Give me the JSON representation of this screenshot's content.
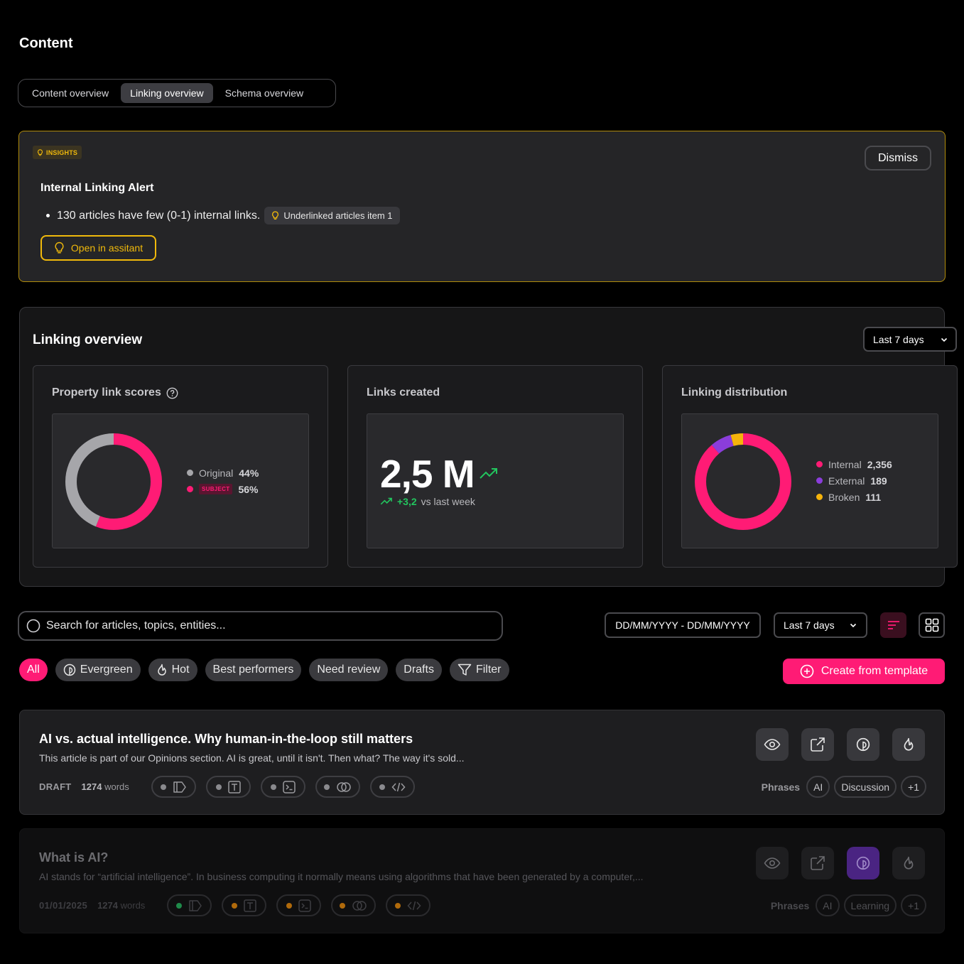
{
  "page": {
    "title": "Content"
  },
  "tabs": [
    {
      "label": "Content overview",
      "active": false
    },
    {
      "label": "Linking overview",
      "active": true
    },
    {
      "label": "Schema overview",
      "active": false
    }
  ],
  "insight": {
    "badge": "INSIGHTS",
    "title": "Internal Linking Alert",
    "bullet": "130 articles have few (0-1) internal links.",
    "chip": "Underlinked articles item 1",
    "assistant_button": "Open in assitant",
    "dismiss_button": "Dismiss"
  },
  "overview": {
    "title": "Linking overview",
    "range": "Last 7 days",
    "cards": {
      "scores": {
        "title": "Property link scores",
        "legend": [
          {
            "label": "Original",
            "value": "44%",
            "color": "#a6a6aa"
          },
          {
            "label": "SUBJECT",
            "value": "56%",
            "color": "#ff1b75"
          }
        ]
      },
      "links": {
        "title": "Links created",
        "value": "2,5 M",
        "delta": "+3,2",
        "delta_label": "vs last week"
      },
      "distribution": {
        "title": "Linking distribution",
        "legend": [
          {
            "label": "Internal",
            "value": "2,356",
            "color": "#ff1b75"
          },
          {
            "label": "External",
            "value": "189",
            "color": "#8b3ddb"
          },
          {
            "label": "Broken",
            "value": "111",
            "color": "#f5b30b"
          }
        ]
      }
    }
  },
  "toolbar": {
    "search_placeholder": "Search for articles, topics, entities...",
    "date_range": "DD/MM/YYYY - DD/MM/YYYY",
    "range": "Last 7 days",
    "create_button": "Create from template"
  },
  "filters": [
    {
      "label": "All",
      "icon": "",
      "active": true
    },
    {
      "label": "Evergreen",
      "icon": "leaf-icon",
      "active": false
    },
    {
      "label": "Hot",
      "icon": "flame-icon",
      "active": false
    },
    {
      "label": "Best performers",
      "icon": "",
      "active": false
    },
    {
      "label": "Need review",
      "icon": "",
      "active": false
    },
    {
      "label": "Drafts",
      "icon": "",
      "active": false
    },
    {
      "label": "Filter",
      "icon": "funnel-icon",
      "active": false
    }
  ],
  "articles": [
    {
      "title": "AI vs. actual intelligence. Why human-in-the-loop still matters",
      "excerpt": "This article is part of our Opinions section. AI is great, until it isn't. Then what? The way it's sold...",
      "status": "DRAFT",
      "words": "1274",
      "words_label": "words",
      "phrases_label": "Phrases",
      "phrases": [
        "AI",
        "Discussion",
        "+1"
      ],
      "pill_colors": [
        "#8a8a8e",
        "#8a8a8e",
        "#8a8a8e",
        "#8a8a8e",
        "#8a8a8e"
      ]
    },
    {
      "title": "What is AI?",
      "excerpt": "AI stands for “artificial intelligence”. In business computing it normally means using algorithms that have been generated by a computer,...",
      "status": "01/01/2025",
      "words": "1274",
      "words_label": "words",
      "phrases_label": "Phrases",
      "phrases": [
        "AI",
        "Learning",
        "+1"
      ],
      "pill_colors": [
        "#1f8a4a",
        "#b06a0b",
        "#b06a0b",
        "#b06a0b",
        "#b06a0b"
      ]
    }
  ]
}
